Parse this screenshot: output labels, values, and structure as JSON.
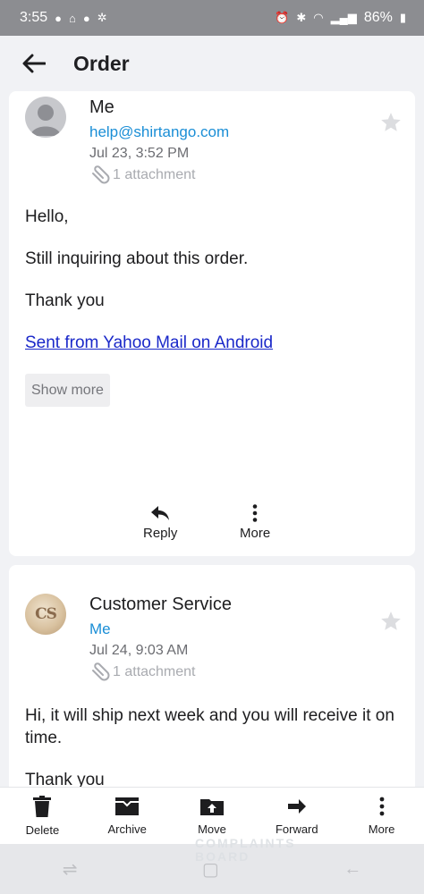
{
  "status_bar": {
    "time": "3:55",
    "battery": "86%"
  },
  "app_bar": {
    "title": "Order"
  },
  "messages": [
    {
      "sender": "Me",
      "recipient": "help@shirtango.com",
      "date": "Jul 23, 3:52 PM",
      "attachments": "1 attachment",
      "body": [
        "Hello,",
        "Still inquiring about this order.",
        "Thank you"
      ],
      "signature_link": "Sent from Yahoo Mail on Android",
      "show_more": "Show more",
      "actions": {
        "reply": "Reply",
        "more": "More"
      }
    },
    {
      "sender": "Customer Service",
      "avatar_initials": "CS",
      "recipient": "Me",
      "date": "Jul 24, 9:03 AM",
      "attachments": "1 attachment",
      "body": [
        "Hi, it will ship next week and you will receive it on time.",
        "Thank you"
      ]
    }
  ],
  "toolbar": {
    "delete": "Delete",
    "archive": "Archive",
    "move": "Move",
    "forward": "Forward",
    "more": "More"
  },
  "watermark": {
    "line1": "COMPLAINTS",
    "line2": "BOARD"
  },
  "colors": {
    "link": "#1a28c9",
    "accent": "#1a8ed6",
    "status_bar": "#8c8d91"
  }
}
